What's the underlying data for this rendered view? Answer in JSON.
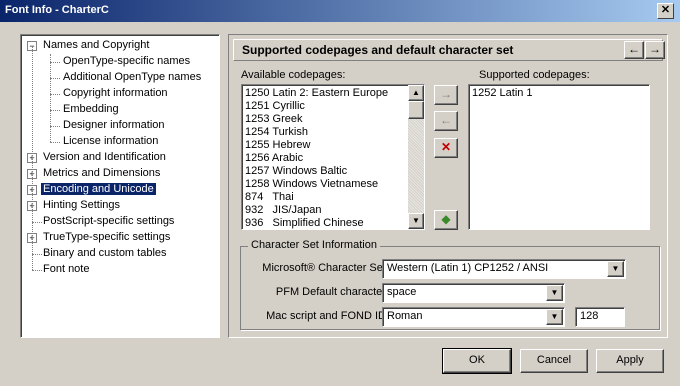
{
  "window": {
    "title": "Font Info - CharterC",
    "close_glyph": "✕"
  },
  "tree": {
    "items": [
      {
        "label": "Names and Copyright",
        "expander": "−"
      },
      {
        "label": "OpenType-specific names"
      },
      {
        "label": "Additional OpenType names"
      },
      {
        "label": "Copyright information"
      },
      {
        "label": "Embedding"
      },
      {
        "label": "Designer information"
      },
      {
        "label": "License information"
      },
      {
        "label": "Version and Identification",
        "expander": "+"
      },
      {
        "label": "Metrics and Dimensions",
        "expander": "+"
      },
      {
        "label": "Encoding and Unicode",
        "expander": "+",
        "selected": true
      },
      {
        "label": "Hinting Settings",
        "expander": "+"
      },
      {
        "label": "PostScript-specific settings"
      },
      {
        "label": "TrueType-specific settings",
        "expander": "+"
      },
      {
        "label": "Binary and custom tables"
      },
      {
        "label": "Font note"
      }
    ]
  },
  "panel": {
    "header": "Supported codepages and  default character set",
    "back_glyph": "←",
    "forward_glyph": "→",
    "available_label": "Available codepages:",
    "supported_label": "Supported codepages:",
    "available": [
      "1250 Latin 2: Eastern Europe",
      "1251 Cyrillic",
      "1253 Greek",
      "1254 Turkish",
      "1255 Hebrew",
      "1256 Arabic",
      "1257 Windows Baltic",
      "1258 Windows Vietnamese",
      "874   Thai",
      "932   JIS/Japan",
      "936   Simplified Chinese"
    ],
    "supported": [
      "1252 Latin 1"
    ],
    "scroll_up": "▲",
    "scroll_down": "▼",
    "add_glyph": "→",
    "remove_glyph": "←",
    "delete_glyph": "✕",
    "apply_glyph": "◆"
  },
  "charset": {
    "caption": "Character Set Information",
    "ms_label": "Microsoft® Character Set:",
    "ms_value": "Western (Latin 1) CP1252 / ANSI",
    "pfm_label": "PFM Default character:",
    "pfm_value": "space",
    "mac_label": "Mac script and FOND ID:",
    "mac_value": "Roman",
    "fond_id": "128",
    "dropdown_glyph": "▼"
  },
  "buttons": {
    "ok": "OK",
    "cancel": "Cancel",
    "apply": "Apply"
  },
  "colors": {
    "title_start": "#0a246a",
    "title_end": "#a6caf0",
    "selection": "#0a246a",
    "face": "#d4d0c8",
    "delete_red": "#c00000"
  }
}
